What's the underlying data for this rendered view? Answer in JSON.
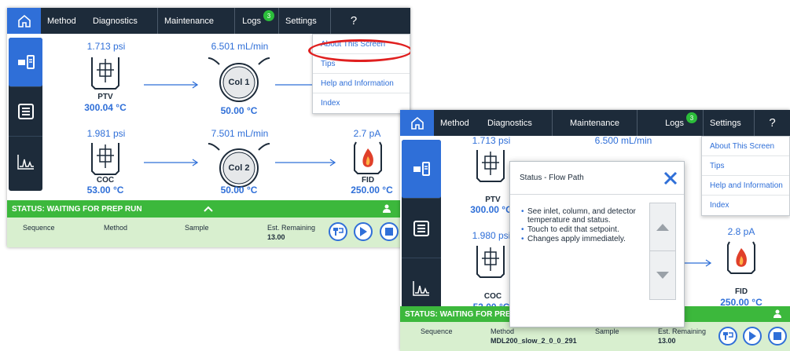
{
  "screen_a": {
    "tabs": {
      "method": "Method",
      "diagnostics": "Diagnostics",
      "maintenance": "Maintenance",
      "logs": "Logs",
      "logs_badge": "3",
      "settings": "Settings",
      "help": "?"
    },
    "flow": {
      "inlet1": {
        "pressure": "1.713 psi",
        "name": "PTV",
        "temp": "300.04 °C"
      },
      "column1": {
        "flow": "6.501 mL/min",
        "name": "Col 1",
        "temp": "50.00 °C"
      },
      "inlet2": {
        "pressure": "1.981 psi",
        "name": "COC",
        "temp": "53.00 °C"
      },
      "column2": {
        "flow": "7.501 mL/min",
        "name": "Col 2",
        "temp": "50.00 °C"
      },
      "detector": {
        "signal": "2.7 pA",
        "name": "FID",
        "temp": "250.00 °C"
      }
    },
    "menu": [
      "About This Screen",
      "Tips",
      "Help and Information",
      "Index"
    ],
    "status": "STATUS: WAITING FOR PREP RUN",
    "info": {
      "sequence": "Sequence",
      "method": "Method",
      "sample": "Sample",
      "remaining_label": "Est. Remaining",
      "remaining_value": "13.00"
    }
  },
  "screen_b": {
    "tabs": {
      "method": "Method",
      "diagnostics": "Diagnostics",
      "maintenance": "Maintenance",
      "logs": "Logs",
      "logs_badge": "3",
      "settings": "Settings",
      "help": "?"
    },
    "flow": {
      "inlet1": {
        "pressure": "1.713 psi",
        "name": "PTV",
        "temp": "300.00 °C"
      },
      "column1": {
        "flow": "6.500 mL/min"
      },
      "inlet2": {
        "pressure": "1.980 psi",
        "name": "COC",
        "temp": "53.00 °C"
      },
      "detector": {
        "signal": "2.8 pA",
        "name": "FID",
        "temp": "250.00 °C"
      }
    },
    "menu": [
      "About This Screen",
      "Tips",
      "Help and Information",
      "Index"
    ],
    "dialog": {
      "title": "Status - Flow Path",
      "bullets": [
        "See inlet, column, and detector temperature and status.",
        "Touch to edit that setpoint.",
        "Changes apply immediately."
      ]
    },
    "status": "STATUS: WAITING FOR PREP RUN",
    "info": {
      "sequence": "Sequence",
      "method": "Method",
      "method_value": "MDL200_slow_2_0_0_291",
      "sample": "Sample",
      "remaining_label": "Est. Remaining",
      "remaining_value": "13.00"
    }
  },
  "colors": {
    "nav_dark": "#1d2b3a",
    "accent_blue": "#2f6fd8",
    "status_green": "#3cb83c",
    "info_green": "#d8efcf",
    "badge_green": "#2bbd3a",
    "highlight_red": "#e02020",
    "flame_red": "#e0402a"
  },
  "icons": [
    "home-icon",
    "flow-path-icon",
    "list-icon",
    "chromatogram-icon",
    "inlet-icon",
    "column-icon",
    "detector-flame-icon",
    "person-icon",
    "chevron-up-icon",
    "prep-run-icon",
    "play-icon",
    "stop-icon",
    "close-icon",
    "scroll-up-icon",
    "scroll-down-icon"
  ]
}
